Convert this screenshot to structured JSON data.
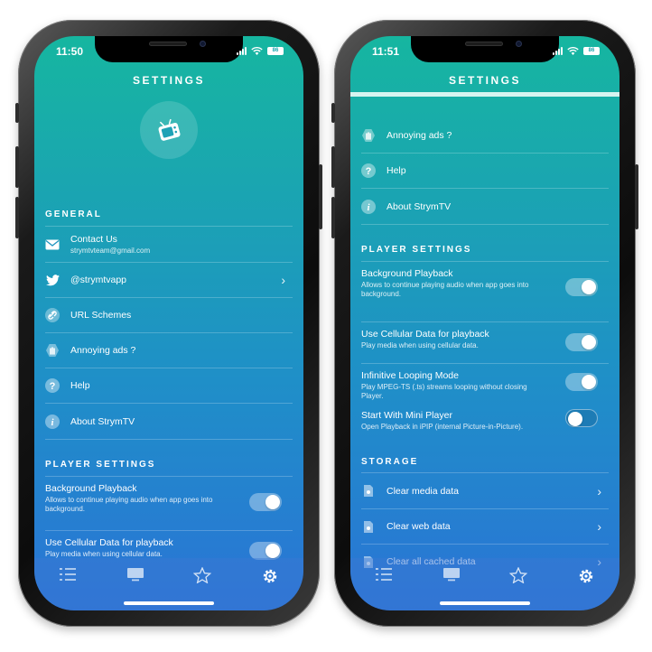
{
  "left_screen": {
    "time": "11:50",
    "battery": "86",
    "title": "SETTINGS",
    "general_header": "GENERAL",
    "items": [
      {
        "label": "Contact Us",
        "sub": "strymtvteam@gmail.com",
        "icon": "mail-icon"
      },
      {
        "label": "@strymtvapp",
        "icon": "twitter-icon"
      },
      {
        "label": "URL Schemes",
        "icon": "link-icon"
      },
      {
        "label": "Annoying ads ?",
        "icon": "hand-icon"
      },
      {
        "label": "Help",
        "icon": "question-icon"
      },
      {
        "label": "About StrymTV",
        "icon": "info-icon"
      }
    ],
    "player_header": "PLAYER SETTINGS",
    "player_settings": [
      {
        "title": "Background Playback",
        "desc": "Allows to continue playing audio when app goes into background.",
        "on": true
      },
      {
        "title": "Use Cellular Data for playback",
        "desc": "Play media when using cellular data.",
        "on": true
      }
    ]
  },
  "right_screen": {
    "time": "11:51",
    "battery": "86",
    "title": "SETTINGS",
    "items": [
      {
        "label": "Annoying ads ?",
        "icon": "hand-icon"
      },
      {
        "label": "Help",
        "icon": "question-icon"
      },
      {
        "label": "About StrymTV",
        "icon": "info-icon"
      }
    ],
    "player_header": "PLAYER SETTINGS",
    "player_settings": [
      {
        "title": "Background Playback",
        "desc": "Allows to continue playing audio when app goes into background.",
        "on": true
      },
      {
        "title": "Use Cellular Data for playback",
        "desc": "Play media when using cellular data.",
        "on": true
      },
      {
        "title": "Infinitive Looping Mode",
        "desc": "Play MPEG-TS (.ts) streams looping without closing Player.",
        "on": true
      },
      {
        "title": "Start With Mini Player",
        "desc": "Open Playback in iPIP (internal Picture-in-Picture).",
        "on": false
      }
    ],
    "storage_header": "STORAGE",
    "storage_items": [
      {
        "label": "Clear media data",
        "icon": "file-icon"
      },
      {
        "label": "Clear web data",
        "icon": "file-icon"
      },
      {
        "label": "Clear all cached data",
        "icon": "file-icon"
      }
    ]
  },
  "tabs": [
    {
      "name": "list-icon"
    },
    {
      "name": "tv-icon"
    },
    {
      "name": "star-icon"
    },
    {
      "name": "gear-icon",
      "active": true
    }
  ],
  "colors": {
    "gradient_top": "#16b6a0",
    "gradient_bottom": "#2a74d6"
  }
}
